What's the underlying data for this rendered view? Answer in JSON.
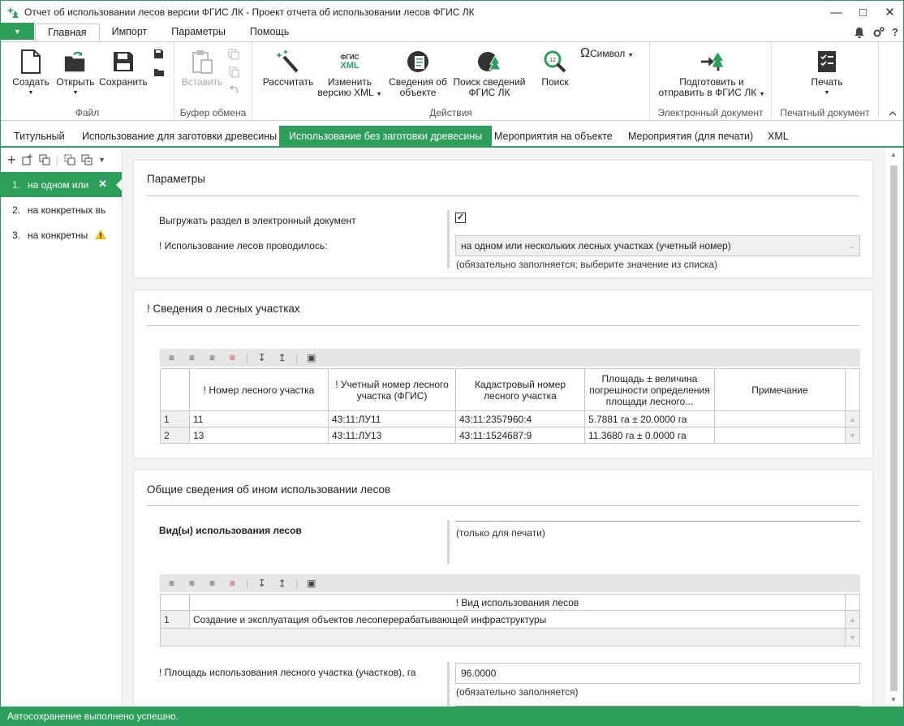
{
  "window": {
    "title": "Отчет об использовании лесов версии ФГИС ЛК - Проект отчета об использовании лесов ФГИС ЛК",
    "controls": [
      "minimize-icon",
      "maximize-icon",
      "close-icon"
    ]
  },
  "menu": {
    "menu_button": "▼",
    "tabs": [
      "Главная",
      "Импорт",
      "Параметры",
      "Помощь"
    ],
    "active_tab": "Главная",
    "right_icons": [
      "bell-icon",
      "gears-icon",
      "help-icon"
    ],
    "help_label": "?"
  },
  "ribbon": {
    "groups": {
      "file": "Файл",
      "clipboard": "Буфер обмена",
      "actions": "Действия",
      "edoc": "Электронный документ",
      "print": "Печатный документ"
    },
    "buttons": {
      "create": "Создать",
      "open": "Открыть",
      "save": "Сохранить",
      "paste": "Вставить",
      "calc": "Рассчитать",
      "xml_badge_top": "ФГИС",
      "xml_badge_bottom": "XML",
      "change_xml_1": "Изменить",
      "change_xml_2": "версию XML",
      "object_info_1": "Сведения об",
      "object_info_2": "объекте",
      "search_fgis_1": "Поиск сведений",
      "search_fgis_2": "ФГИС ЛК",
      "search": "Поиск",
      "search_badge": "12",
      "symbol_glyph": "Ω",
      "symbol": "Символ",
      "prepare_1": "Подготовить и",
      "prepare_2": "отправить в ФГИС ЛК",
      "print": "Печать"
    }
  },
  "doc_tabs": [
    "Титульный",
    "Использование для заготовки древесины",
    "Использование без заготовки древесины",
    "Мероприятия на объекте",
    "Мероприятия (для печати)",
    "XML"
  ],
  "active_doc_tab": "Использование без заготовки древесины",
  "sidebar": {
    "tool_icons": [
      "add-icon",
      "add-child-icon",
      "copy-icon",
      "copy-all-icon",
      "duplicate-icon",
      "more-icon"
    ],
    "items": [
      {
        "num": "1.",
        "label": "на одном или",
        "state": "active"
      },
      {
        "num": "2.",
        "label": "на конкретных вь",
        "state": ""
      },
      {
        "num": "3.",
        "label": "на конкретны",
        "state": "warning"
      }
    ],
    "close_glyph": "✕"
  },
  "params": {
    "title": "Параметры",
    "export_label": "Выгружать раздел в электронный документ",
    "export_checked": true,
    "check_glyph": "✓",
    "usage_label": "! Использование лесов проводилось:",
    "usage_value": "на одном или нескольких лесных участках (учетный номер)",
    "usage_hint": "(обязательно заполняется; выберите значение из списка)"
  },
  "plots": {
    "title": "! Сведения о лесных участках",
    "columns": [
      "! Номер лесного участка",
      "! Учетный номер лесного участка (ФГИС)",
      "Кадастровый номер лесного участка",
      "Площадь ± величина погрешности определения площади лесного...",
      "Примечание"
    ],
    "rows": [
      {
        "n": "1",
        "plot_no": "11",
        "account_no": "43:11:ЛУ11",
        "cadastral": "43:11:2357960:4",
        "area": "5.7881 га ± 20.0000 га",
        "note": ""
      },
      {
        "n": "2",
        "plot_no": "13",
        "account_no": "43:11:ЛУ13",
        "cadastral": "43:11:1524687:9",
        "area": "11.3680 га ± 0.0000 га",
        "note": ""
      }
    ]
  },
  "general": {
    "title": "Общие сведения об ином использовании лесов",
    "kinds_label": "Вид(ы) использования лесов",
    "kinds_hint": "(только для печати)",
    "kinds_column": "! Вид использования лесов",
    "kinds_rows": [
      {
        "n": "1",
        "value": "Создание и эксплуатация объектов лесоперерабатывающей инфраструктуры"
      }
    ],
    "area_label": "! Площадь использования лесного участка (участков), га",
    "area_value": "96.0000",
    "area_hint": "(обязательно заполняется)"
  },
  "statusbar": {
    "text": "Автосохранение выполнено успешно."
  },
  "colors": {
    "accent": "#2e9e5b",
    "warning": "#f2c200"
  }
}
